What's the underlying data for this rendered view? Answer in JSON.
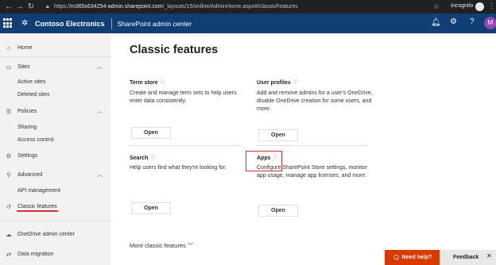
{
  "browser": {
    "url_prefix": "https://",
    "url_host": "m365x634254-admin.sharepoint.com",
    "url_path": "/_layouts/15/online/AdminHome.aspx#/classicFeatures",
    "incognito_label": "Incognito"
  },
  "suite": {
    "brand": "Contoso Electronics",
    "app": "SharePoint admin center",
    "avatar_initial": "M"
  },
  "nav": {
    "home": "Home",
    "sites": "Sites",
    "active_sites": "Active sites",
    "deleted_sites": "Deleted sites",
    "policies": "Policies",
    "sharing": "Sharing",
    "access_control": "Access control",
    "settings": "Settings",
    "advanced": "Advanced",
    "api_management": "API management",
    "classic_features": "Classic features",
    "onedrive_admin": "OneDrive admin center",
    "data_migration": "Data migration"
  },
  "main": {
    "title": "Classic features",
    "cards": [
      {
        "title": "Term store",
        "desc": "Create and manage term sets to help users enter data consistently.",
        "button": "Open"
      },
      {
        "title": "User profiles",
        "desc": "Add and remove admins for a user's OneDrive, disable OneDrive creation for some users, and more.",
        "button": "Open"
      },
      {
        "title": "Search",
        "desc": "Help users find what they're looking for.",
        "button": "Open"
      },
      {
        "title": "Apps",
        "desc": "Configure SharePoint Store settings, monitor app usage, manage app licenses, and more.",
        "button": "Open"
      }
    ],
    "more": "More classic features"
  },
  "widgets": {
    "need_help": "Need help?",
    "feedback": "Feedback"
  },
  "colors": {
    "suite_bar": "#0f3f75",
    "highlight": "#d13438",
    "need_help": "#d83b01"
  }
}
